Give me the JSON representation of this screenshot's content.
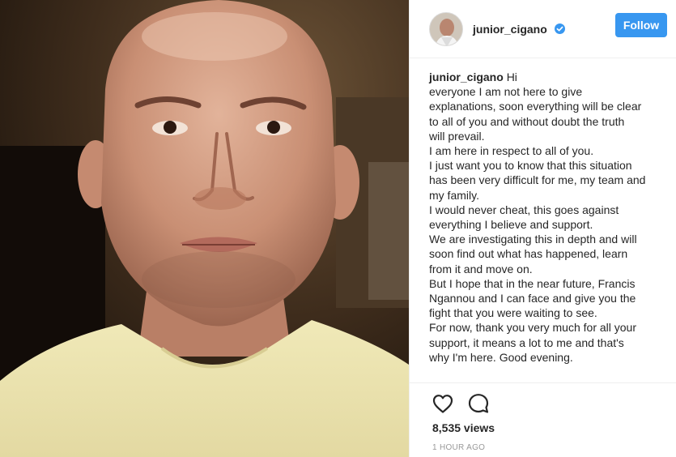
{
  "post": {
    "author": "junior_cigano",
    "verified_icon": "verified-badge-icon",
    "follow_label": "Follow",
    "caption_user": "junior_cigano",
    "caption_lines": [
      "Hi",
      "everyone I am not here to give",
      "explanations, soon everything will be clear",
      "to all of you and without doubt the truth",
      "will prevail.",
      "I am here in respect to all of you.",
      "I just want you to know that this situation",
      "has been very difficult for me, my team and",
      "my family.",
      "I would never cheat, this goes against",
      "everything I believe and support.",
      "We are investigating this in depth and will",
      "soon find out what has happened, learn",
      "from it and move on.",
      "But I hope that in the near future, Francis",
      "Ngannou and I can face and give you the",
      "fight that you were waiting to see.",
      "For now, thank you very much for all your",
      "support, it means a lot to me and that's",
      "why I'm here. Good evening."
    ],
    "views": "8,535 views",
    "timestamp": "1 HOUR AGO"
  },
  "icons": {
    "like": "heart-icon",
    "comment": "comment-bubble-icon"
  },
  "colors": {
    "follow_button": "#3897f0",
    "verified_badge": "#3897f0",
    "timestamp": "#999999"
  }
}
